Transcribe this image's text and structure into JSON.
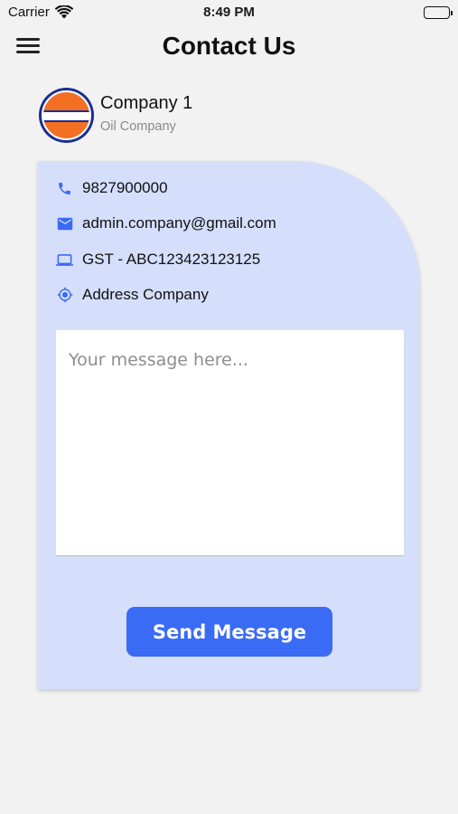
{
  "status_bar": {
    "carrier": "Carrier",
    "time": "8:49 PM"
  },
  "header": {
    "title": "Contact Us",
    "menu_icon": "hamburger-menu-icon"
  },
  "company": {
    "name": "Company 1",
    "type": "Oil Company",
    "logo_icon": "indianoil-logo"
  },
  "contact": {
    "phone": "9827900000",
    "email": "admin.company@gmail.com",
    "gst": "GST - ABC123423123125",
    "address": "Address Company"
  },
  "form": {
    "message_placeholder": "Your message here...",
    "message_value": "",
    "send_label": "Send Message"
  },
  "colors": {
    "background": "#f2f2f2",
    "card": "#d5defa",
    "accent": "#3a6bf5",
    "icon": "#3a6bf5"
  }
}
